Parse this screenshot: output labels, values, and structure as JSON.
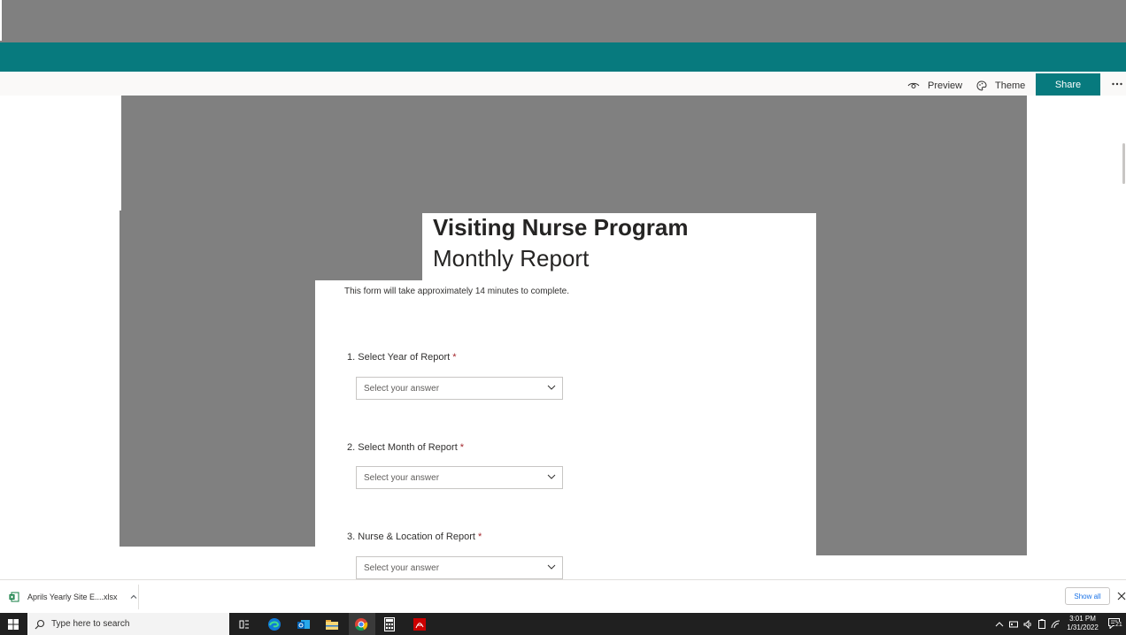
{
  "toolbar": {
    "preview_label": "Preview",
    "theme_label": "Theme",
    "share_label": "Share",
    "more_icon": "more-ellipsis-icon"
  },
  "form": {
    "title": "Visiting Nurse Program",
    "subtitle": "Monthly Report",
    "description": "This form will take approximately 14 minutes to complete.",
    "questions": [
      {
        "number": "1.",
        "label": "Select Year of Report",
        "required": "*",
        "placeholder": "Select your answer"
      },
      {
        "number": "2.",
        "label": "Select Month of Report",
        "required": "*",
        "placeholder": "Select your answer"
      },
      {
        "number": "3.",
        "label": "Nurse & Location of Report",
        "required": "*",
        "placeholder": "Select your answer"
      }
    ]
  },
  "downloads": {
    "file_name": "Aprils Yearly Site E....xlsx",
    "show_all_label": "Show all"
  },
  "taskbar": {
    "search_placeholder": "Type here to search",
    "time": "3:01 PM",
    "date": "1/31/2022",
    "notification_count": "21"
  },
  "colors": {
    "accent": "#077a7e",
    "overlay": "#808080",
    "required": "#a4262c"
  }
}
